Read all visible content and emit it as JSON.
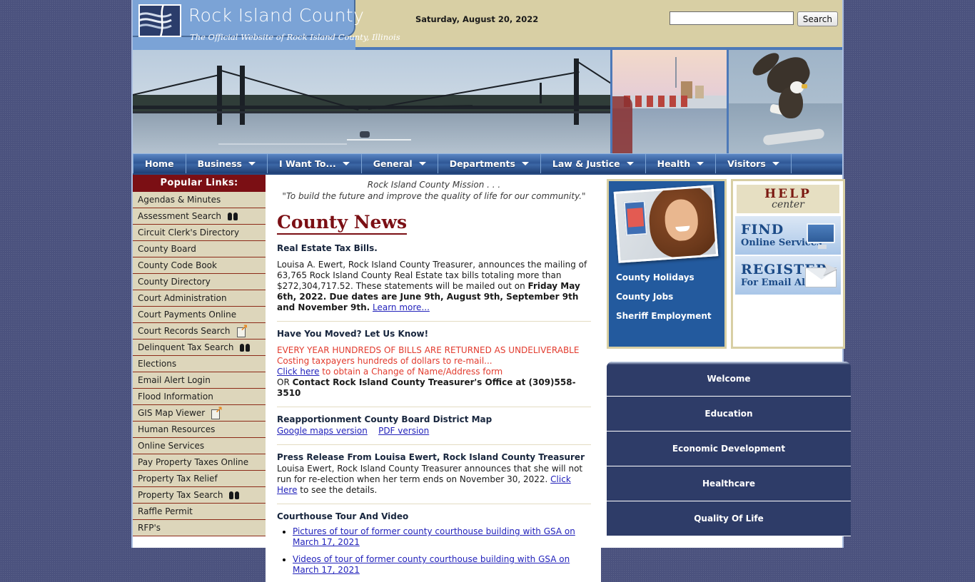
{
  "header": {
    "title": "Rock Island County",
    "subtitle": "The Official Website of Rock Island County, Illinois",
    "date": "Saturday, August 20, 2022",
    "search_value": "",
    "search_placeholder": "",
    "search_button": "Search"
  },
  "nav": [
    {
      "label": "Home",
      "has_caret": false
    },
    {
      "label": "Business",
      "has_caret": true
    },
    {
      "label": "I Want To...",
      "has_caret": true
    },
    {
      "label": "General",
      "has_caret": true
    },
    {
      "label": "Departments",
      "has_caret": true
    },
    {
      "label": "Law & Justice",
      "has_caret": true
    },
    {
      "label": "Health",
      "has_caret": true
    },
    {
      "label": "Visitors",
      "has_caret": true
    }
  ],
  "popular_links": {
    "heading": "Popular Links:",
    "items": [
      {
        "label": "Agendas & Minutes",
        "icon": ""
      },
      {
        "label": "Assessment Search",
        "icon": "binoculars-icon"
      },
      {
        "label": "Circuit Clerk's Directory",
        "icon": ""
      },
      {
        "label": "County Board",
        "icon": ""
      },
      {
        "label": "County Code Book",
        "icon": ""
      },
      {
        "label": "County Directory",
        "icon": ""
      },
      {
        "label": "Court Administration",
        "icon": ""
      },
      {
        "label": "Court Payments Online",
        "icon": ""
      },
      {
        "label": "Court Records Search",
        "icon": "external-link-icon"
      },
      {
        "label": "Delinquent Tax Search",
        "icon": "binoculars-icon"
      },
      {
        "label": "Elections",
        "icon": ""
      },
      {
        "label": "Email Alert Login",
        "icon": ""
      },
      {
        "label": "Flood Information",
        "icon": ""
      },
      {
        "label": "GIS Map Viewer",
        "icon": "external-link-icon"
      },
      {
        "label": "Human Resources",
        "icon": ""
      },
      {
        "label": "Online Services",
        "icon": ""
      },
      {
        "label": "Pay Property Taxes Online",
        "icon": ""
      },
      {
        "label": "Property Tax Relief",
        "icon": ""
      },
      {
        "label": "Property Tax Search",
        "icon": "binoculars-icon"
      },
      {
        "label": "Raffle Permit",
        "icon": ""
      },
      {
        "label": "RFP's",
        "icon": ""
      }
    ]
  },
  "mission": {
    "line1": "Rock Island County Mission . . .",
    "line2": "\"To build the future and improve the quality of life for our community.\""
  },
  "news": {
    "title": "County News",
    "tax_bills": {
      "heading": "Real Estate Tax Bills.",
      "body_1": "Louisa A. Ewert, Rock Island County Treasurer, announces the mailing of 63,765 Rock Island County Real Estate tax bills totaling more than $272,304,717.52. These statements will be mailed out on ",
      "bold_1": "Friday May 6th, 2022.  Due dates are June 9th, August 9th, September 9th and November 9th.",
      "link": "Learn more..."
    },
    "moved": {
      "heading": "Have You Moved? Let Us Know!",
      "red_1": "EVERY YEAR HUNDREDS OF BILLS ARE RETURNED AS UNDELIVERABLE",
      "red_2": "Costing taxpayers hundreds of dollars to re-mail...",
      "link": "Click here",
      "after_link": " to obtain a Change of Name/Address form",
      "or_prefix": "OR ",
      "or_bold": "Contact Rock Island County Treasurer's Office at (309)558-3510"
    },
    "reapportionment": {
      "heading": "Reapportionment County Board District Map",
      "link_1": "Google maps version",
      "link_2": "PDF version"
    },
    "press_release": {
      "heading": "Press Release From Louisa Ewert, Rock Island County Treasurer",
      "body_1": "Louisa Ewert, Rock Island County Treasurer announces that she will not run for re-election when her term ends on November 30, 2022. ",
      "link": "Click Here",
      "body_2": " to see the details."
    },
    "courthouse": {
      "heading": "Courthouse Tour And Video",
      "items": [
        "Pictures of tour of former county courthouse building with GSA on March 17, 2021",
        "Videos of tour of former county courthouse building with GSA on March 17, 2021"
      ]
    }
  },
  "right": {
    "photo_links": [
      "County Holidays",
      "County Jobs",
      "Sheriff Employment"
    ],
    "help_button": {
      "line1": "HELP",
      "line2": "center"
    },
    "find_button": {
      "line1": "FIND",
      "line2": "Online Services"
    },
    "register_button": {
      "line1": "REGISTER",
      "line2": "For Email Alerts"
    },
    "menu": [
      "Welcome",
      "Education",
      "Economic Development",
      "Healthcare",
      "Quality Of Life"
    ]
  },
  "colors": {
    "page_background": "#4b527e",
    "header_tan": "#d8cfa4",
    "brand_blue": "#7ba3d6",
    "nav_blue": "#2f5796",
    "maroon": "#7b0f14",
    "sidebar_tan": "#ddd6bb",
    "link_blue": "#2222bb",
    "alert_red": "#e23b2e",
    "panel_blue": "#235a9e",
    "menu_navy": "#2e3c68"
  }
}
